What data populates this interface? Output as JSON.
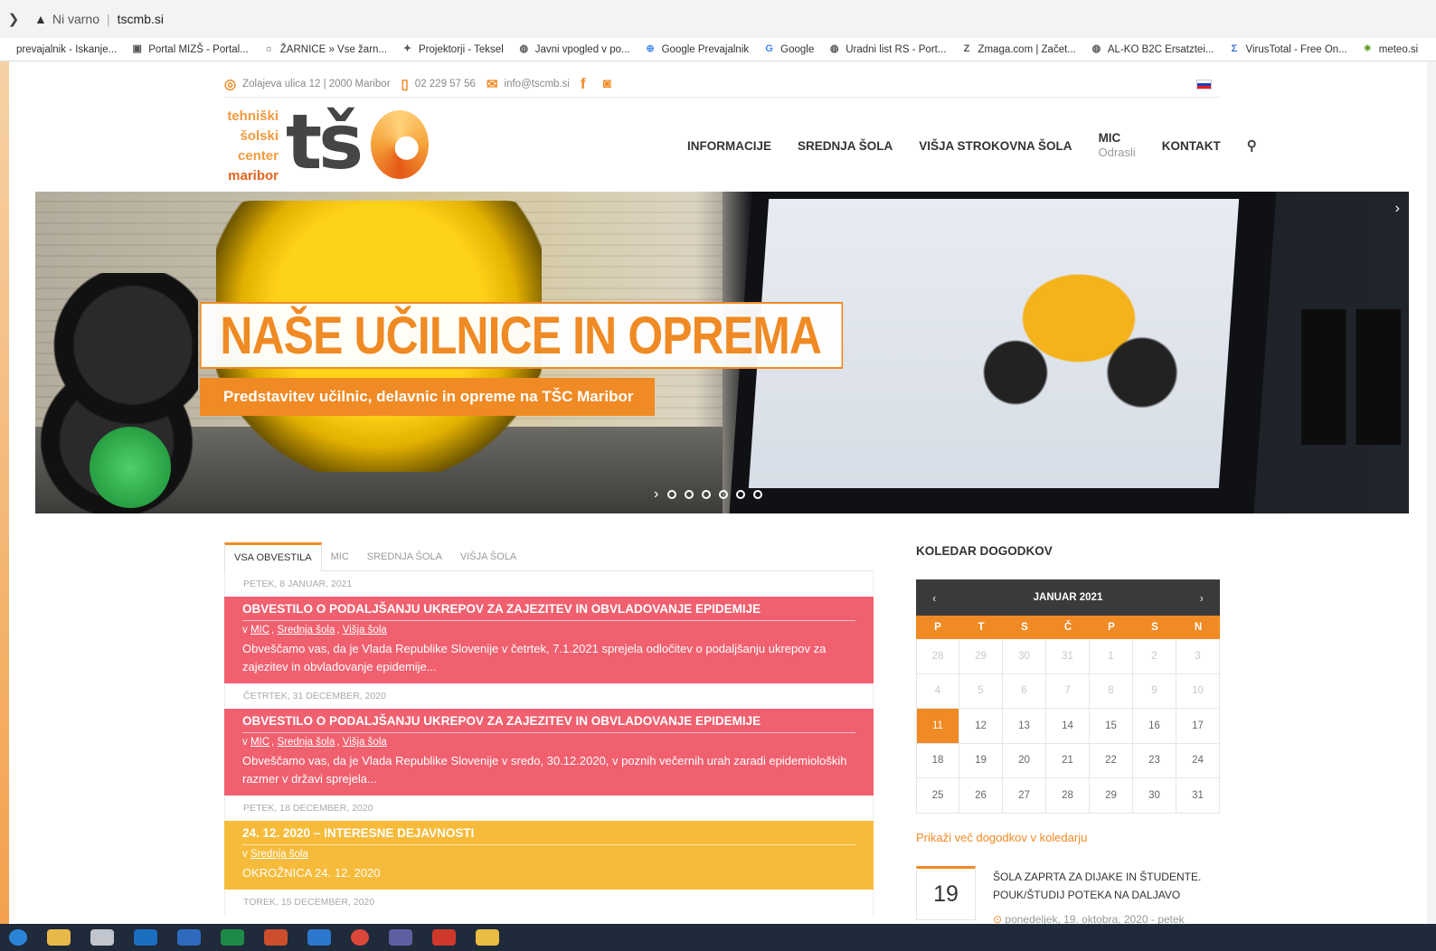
{
  "browser": {
    "security_label": "Ni varno",
    "url": "tscmb.si",
    "bookmarks": [
      {
        "label": "prevajalnik - Iskanje...",
        "icon": "generic-icon"
      },
      {
        "label": "Portal MIZŠ - Portal...",
        "icon": "portal-icon"
      },
      {
        "label": "ŽARNICE » Vse žarn...",
        "icon": "bulb-icon"
      },
      {
        "label": "Projektorji - Teksel",
        "icon": "projector-icon"
      },
      {
        "label": "Javni vpogled v po...",
        "icon": "globe-icon"
      },
      {
        "label": "Google Prevajalnik",
        "icon": "translate-icon"
      },
      {
        "label": "Google",
        "icon": "google-icon"
      },
      {
        "label": "Uradni list RS - Port...",
        "icon": "globe-icon"
      },
      {
        "label": "Zmaga.com | Začet...",
        "icon": "z-icon"
      },
      {
        "label": "AL-KO B2C Ersatztei...",
        "icon": "globe-icon"
      },
      {
        "label": "VirusTotal - Free On...",
        "icon": "sigma-icon"
      },
      {
        "label": "meteo.si",
        "icon": "sun-icon"
      }
    ]
  },
  "topbar": {
    "address": "Zolajeva ulica 12 | 2000 Maribor",
    "phone": "02 229 57 56",
    "email": "info@tscmb.si"
  },
  "logo": {
    "line1": "tehniški",
    "line2": "šolski",
    "line3": "center",
    "line4": "maribor",
    "mark": "tš"
  },
  "nav": {
    "items": [
      "INFORMACIJE",
      "SREDNJA ŠOLA",
      "VIŠJA STROKOVNA ŠOLA"
    ],
    "mic_label": "MIC",
    "mic_sub": "Odrasli",
    "contact": "KONTAKT"
  },
  "hero": {
    "title": "NAŠE UČILNICE IN OPREMA",
    "subtitle": "Predstavitev učilnic, delavnic in opreme na TŠC Maribor",
    "slide_count": 6
  },
  "news": {
    "tabs": [
      "VSA OBVESTILA",
      "MIC",
      "SREDNJA ŠOLA",
      "VIŠJA ŠOLA"
    ],
    "items": [
      {
        "date": "PETEK, 8 JANUAR, 2021",
        "title": "OBVESTILO O PODALJŠANJU UKREPOV ZA ZAJEZITEV IN OBVLADOVANJE EPIDEMIJE",
        "cat_prefix": "v",
        "cats": [
          "MIC",
          "Srednja šola",
          "Višja šola"
        ],
        "text": "Obveščamo vas, da je Vlada Republike Slovenije v četrtek, 7.1.2021 sprejela odločitev o podaljšanju ukrepov za zajezitev in obvladovanje epidemije...",
        "color": "#f0606f"
      },
      {
        "date": "ČETRTEK, 31 DECEMBER, 2020",
        "title": "OBVESTILO O PODALJŠANJU UKREPOV ZA ZAJEZITEV IN OBVLADOVANJE EPIDEMIJE",
        "cat_prefix": "v",
        "cats": [
          "MIC",
          "Srednja šola",
          "Višja šola"
        ],
        "text": "Obveščamo vas, da je Vlada Republike Slovenije v sredo, 30.12.2020, v poznih večernih urah zaradi epidemioloških razmer v državi sprejela...",
        "color": "#f0606f"
      },
      {
        "date": "PETEK, 18 DECEMBER, 2020",
        "title": "24. 12. 2020 – INTERESNE DEJAVNOSTI",
        "cat_prefix": "v",
        "cats": [
          "Srednja šola"
        ],
        "text": "OKROŽNICA 24. 12. 2020",
        "color": "#f6bb3a"
      }
    ],
    "next_date": "TOREK, 15 DECEMBER, 2020"
  },
  "calendar": {
    "title": "KOLEDAR DOGODKOV",
    "month": "JANUAR 2021",
    "weekdays": [
      "P",
      "T",
      "S",
      "Č",
      "P",
      "S",
      "N"
    ],
    "weeks": [
      [
        "28",
        "29",
        "30",
        "31",
        "1",
        "2",
        "3"
      ],
      [
        "4",
        "5",
        "6",
        "7",
        "8",
        "9",
        "10"
      ],
      [
        "11",
        "12",
        "13",
        "14",
        "15",
        "16",
        "17"
      ],
      [
        "18",
        "19",
        "20",
        "21",
        "22",
        "23",
        "24"
      ],
      [
        "25",
        "26",
        "27",
        "28",
        "29",
        "30",
        "31"
      ]
    ],
    "muted_first_week": [
      0,
      1,
      2,
      3,
      4,
      5,
      6
    ],
    "muted_second_week": [
      0,
      1,
      2,
      3,
      4,
      5,
      6
    ],
    "today": "11",
    "more_link": "Prikaži več dogodkov v koledarju"
  },
  "event": {
    "day": "19",
    "title": "ŠOLA ZAPRTA ZA DIJAKE IN ŠTUDENTE. POUK/ŠTUDIJ POTEKA NA DALJAVO",
    "meta": "ponedeljek, 19. oktobra, 2020 - petek"
  }
}
